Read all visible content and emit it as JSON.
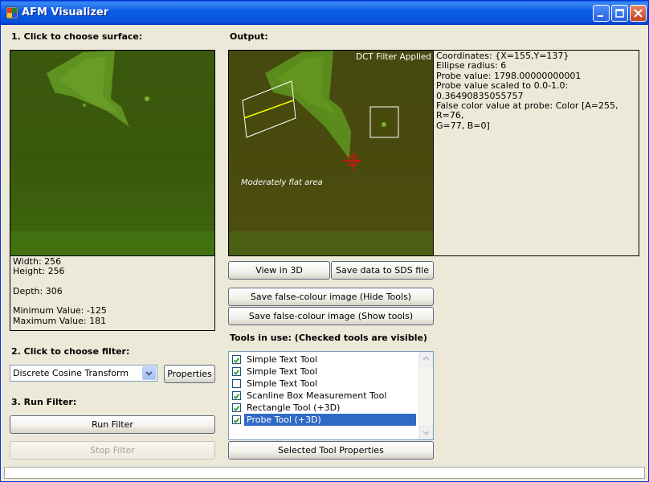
{
  "window": {
    "title": "AFM Visualizer",
    "controls": [
      "minimize",
      "maximize",
      "close"
    ]
  },
  "left": {
    "step1_label": "1. Click to choose surface:",
    "surface_info": {
      "width": "Width:  256",
      "height": "Height: 256",
      "depth": "Depth: 306",
      "min": "Minimum Value: -125",
      "max": "Maximum Value: 181"
    },
    "step2_label": "2. Click to choose filter:",
    "filter_select": {
      "value": "Discrete Cosine Transform"
    },
    "properties_label": "Properties",
    "step3_label": "3. Run Filter:",
    "run_label": "Run Filter",
    "stop_label": "Stop Filter"
  },
  "right": {
    "output_label": "Output:",
    "overlay_text": "DCT Filter Applied",
    "annotation_text": "Moderately flat area",
    "probe_info": [
      "Coordinates: {X=155,Y=137}",
      "Ellipse radius: 6",
      "Probe value: 1798.00000000001",
      "Probe value scaled to 0.0-1.0:",
      "0.36490835055757",
      "False color value at probe: Color [A=255, R=76,",
      "G=77, B=0]"
    ],
    "view3d_label": "View in 3D",
    "save_sds_label": "Save data to SDS file",
    "save_hide_label": "Save false-colour image (Hide Tools)",
    "save_show_label": "Save false-colour image (Show tools)",
    "tools_label": "Tools in use: (Checked tools are visible)",
    "tools": [
      {
        "label": "Simple Text Tool",
        "checked": true,
        "selected": false
      },
      {
        "label": "Simple Text Tool",
        "checked": true,
        "selected": false
      },
      {
        "label": "Simple Text Tool",
        "checked": false,
        "selected": false
      },
      {
        "label": "Scanline Box Measurement Tool",
        "checked": true,
        "selected": false
      },
      {
        "label": "Rectangle Tool (+3D)",
        "checked": true,
        "selected": false
      },
      {
        "label": "Probe Tool (+3D)",
        "checked": true,
        "selected": true
      }
    ],
    "tool_props_label": "Selected Tool Properties"
  },
  "colors": {
    "surface_dark": "#2c4a08",
    "surface_bright": "#6fa82a",
    "output_tint": "#5a3a10",
    "selection": "#316ac5",
    "probe_marker": "#e01010"
  }
}
